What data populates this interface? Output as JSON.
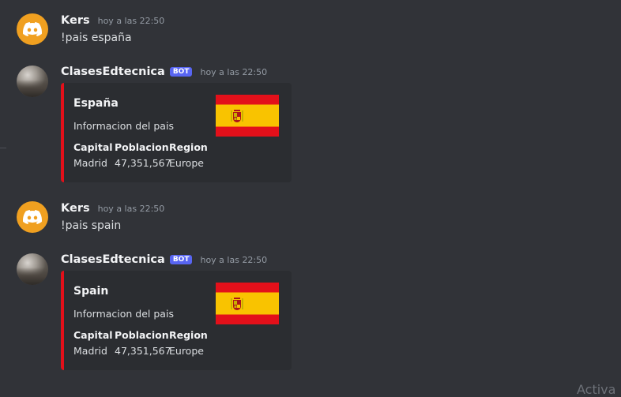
{
  "messages": [
    {
      "author": "Kers",
      "time": "hoy a las 22:50",
      "text": "!pais españa",
      "avatar": "discord-logo-icon"
    },
    {
      "author": "ClasesEdtecnica",
      "badge": "BOT",
      "time": "hoy a las 22:50",
      "avatar": "profile-photo",
      "embed": {
        "title": "España",
        "description": "Informacion del pais",
        "accent": "#e3101a",
        "thumbnail": "spain-flag",
        "fields": [
          {
            "name": "Capital",
            "value": "Madrid"
          },
          {
            "name": "Poblacion",
            "value": "47,351,567"
          },
          {
            "name": "Region",
            "value": "Europe"
          }
        ]
      }
    },
    {
      "author": "Kers",
      "time": "hoy a las 22:50",
      "text": "!pais spain",
      "avatar": "discord-logo-icon"
    },
    {
      "author": "ClasesEdtecnica",
      "badge": "BOT",
      "time": "hoy a las 22:50",
      "avatar": "profile-photo",
      "embed": {
        "title": "Spain",
        "description": "Informacion del pais",
        "accent": "#e3101a",
        "thumbnail": "spain-flag",
        "fields": [
          {
            "name": "Capital",
            "value": "Madrid"
          },
          {
            "name": "Poblacion",
            "value": "47,351,567"
          },
          {
            "name": "Region",
            "value": "Europe"
          }
        ]
      }
    }
  ],
  "watermark": "Activa",
  "colors": {
    "background": "#313338",
    "embed_bg": "#2b2d31",
    "bot_badge": "#5865f2",
    "discord_avatar": "#f0a020"
  }
}
